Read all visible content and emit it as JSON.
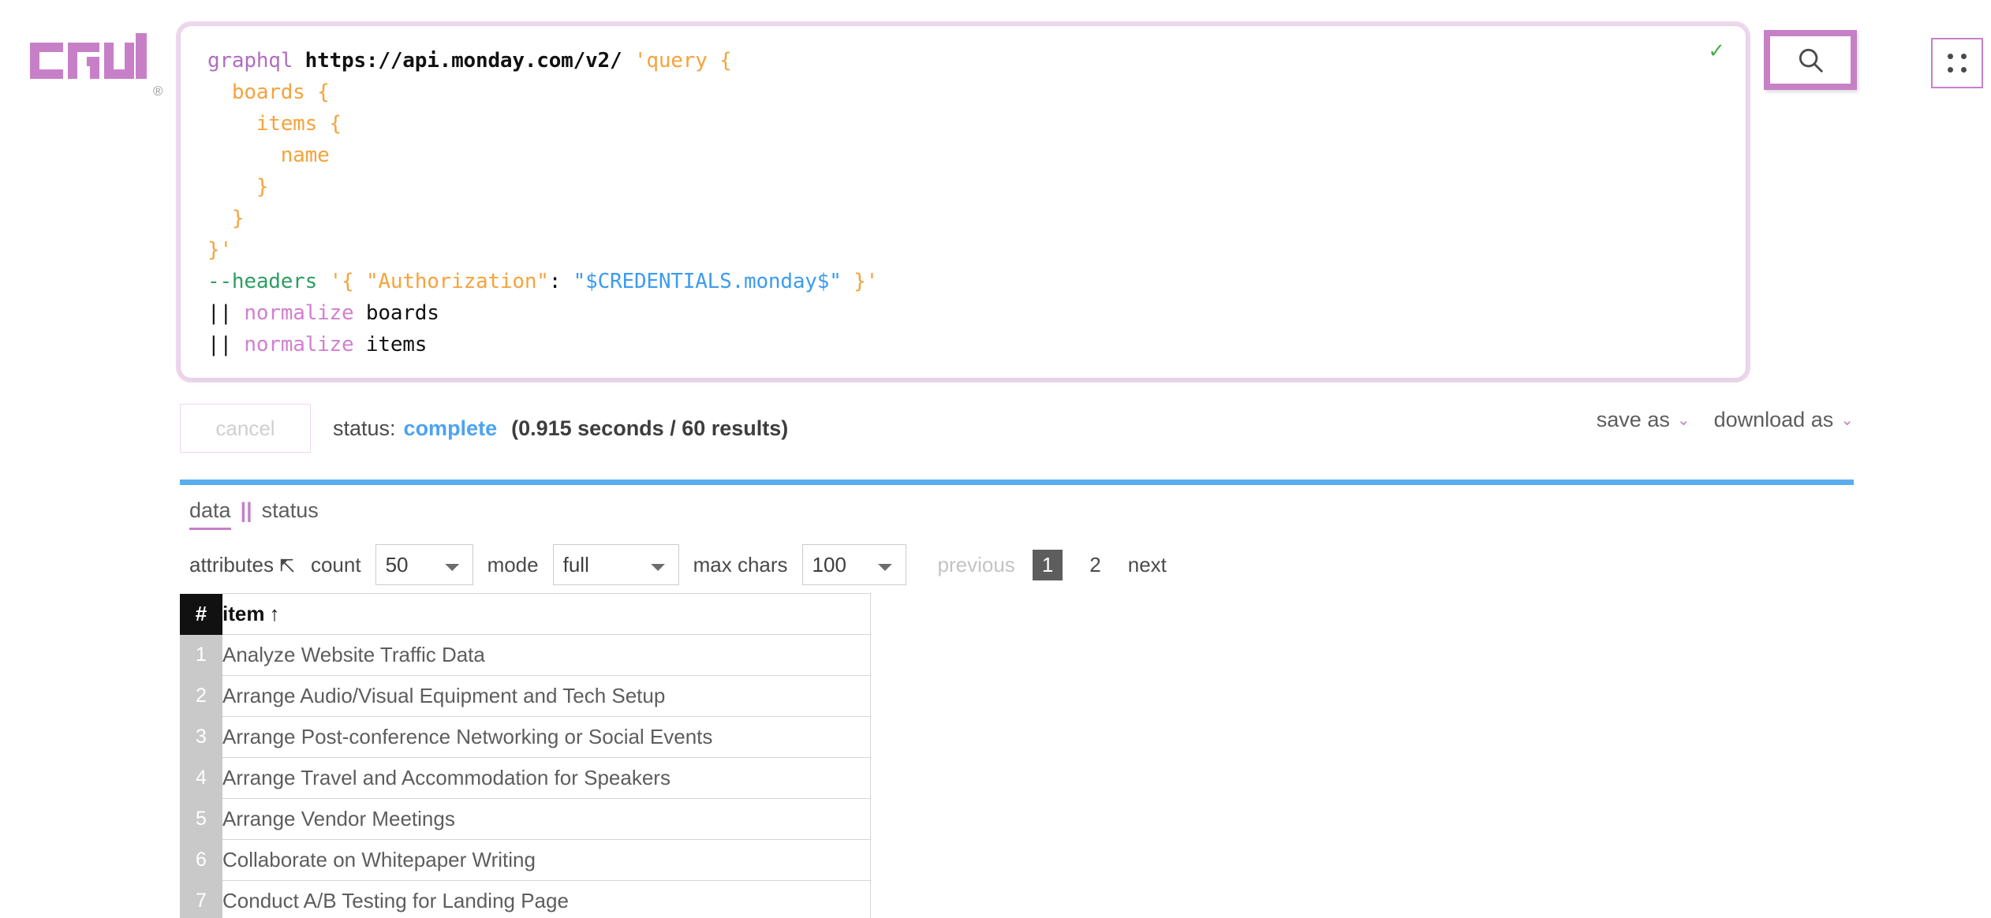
{
  "brand": {
    "name": "crul",
    "registered_mark": "®"
  },
  "query_editor": {
    "valid_icon": "✓",
    "lines": [
      [
        {
          "text": "graphql",
          "type": "cmd"
        },
        {
          "text": " ",
          "type": "plain"
        },
        {
          "text": "https://api.monday.com/v2/",
          "type": "url"
        },
        {
          "text": " ",
          "type": "plain"
        },
        {
          "text": "'query {",
          "type": "str"
        }
      ],
      [
        {
          "text": "  boards {",
          "type": "str"
        }
      ],
      [
        {
          "text": "    items {",
          "type": "str"
        }
      ],
      [
        {
          "text": "      name",
          "type": "str"
        }
      ],
      [
        {
          "text": "    }",
          "type": "str"
        }
      ],
      [
        {
          "text": "  }",
          "type": "str"
        }
      ],
      [
        {
          "text": "}'",
          "type": "str"
        }
      ],
      [
        {
          "text": "--headers",
          "type": "flag"
        },
        {
          "text": " ",
          "type": "plain"
        },
        {
          "text": "'{ ",
          "type": "str"
        },
        {
          "text": "\"Authorization\"",
          "type": "str"
        },
        {
          "text": ": ",
          "type": "plain"
        },
        {
          "text": "\"$CREDENTIALS.monday$\"",
          "type": "var"
        },
        {
          "text": " }'",
          "type": "str"
        }
      ],
      [
        {
          "text": "|| ",
          "type": "pipe"
        },
        {
          "text": "normalize",
          "type": "norm"
        },
        {
          "text": " boards",
          "type": "plain"
        }
      ],
      [
        {
          "text": "|| ",
          "type": "pipe"
        },
        {
          "text": "normalize",
          "type": "norm"
        },
        {
          "text": " items",
          "type": "plain"
        }
      ]
    ]
  },
  "top_actions": {
    "search_icon": "search-icon",
    "grid_icon": "grid-menu-icon"
  },
  "status_bar": {
    "cancel_label": "cancel",
    "status_prefix": "status:",
    "status_value": "complete",
    "status_meta": "(0.915 seconds / 60 results)",
    "save_as_label": "save as",
    "download_as_label": "download as",
    "chevron": "⌄"
  },
  "tabs": {
    "separator": "||",
    "items": [
      {
        "label": "data",
        "active": true
      },
      {
        "label": "status",
        "active": false
      }
    ]
  },
  "toolbar": {
    "attributes_label": "attributes",
    "attributes_icon": "arrow-up-left-icon",
    "count_label": "count",
    "count_value": "50",
    "count_options": [
      "50"
    ],
    "mode_label": "mode",
    "mode_value": "full",
    "mode_options": [
      "full"
    ],
    "max_chars_label": "max chars",
    "max_chars_value": "100",
    "max_chars_options": [
      "100"
    ],
    "pagination": {
      "previous_label": "previous",
      "next_label": "next",
      "pages": [
        "1",
        "2"
      ],
      "current_page": "1"
    }
  },
  "table": {
    "headers": {
      "index": "#",
      "item": "item",
      "sort_arrow": "↑"
    },
    "rows": [
      {
        "n": "1",
        "item": "Analyze Website Traffic Data"
      },
      {
        "n": "2",
        "item": "Arrange Audio/Visual Equipment and Tech Setup"
      },
      {
        "n": "3",
        "item": "Arrange Post-conference Networking or Social Events"
      },
      {
        "n": "4",
        "item": "Arrange Travel and Accommodation for Speakers"
      },
      {
        "n": "5",
        "item": "Arrange Vendor Meetings"
      },
      {
        "n": "6",
        "item": "Collaborate on Whitepaper Writing"
      },
      {
        "n": "7",
        "item": "Conduct A/B Testing for Landing Page"
      }
    ]
  },
  "colors": {
    "brand_purple": "#c780c7",
    "accent_blue": "#5aaef0",
    "status_blue": "#4da3f0",
    "syntax_command": "#b06ec0",
    "syntax_string": "#f5a33c",
    "syntax_flag": "#2e9e62",
    "syntax_variable": "#3d9bf0",
    "check_green": "#4caf50"
  }
}
